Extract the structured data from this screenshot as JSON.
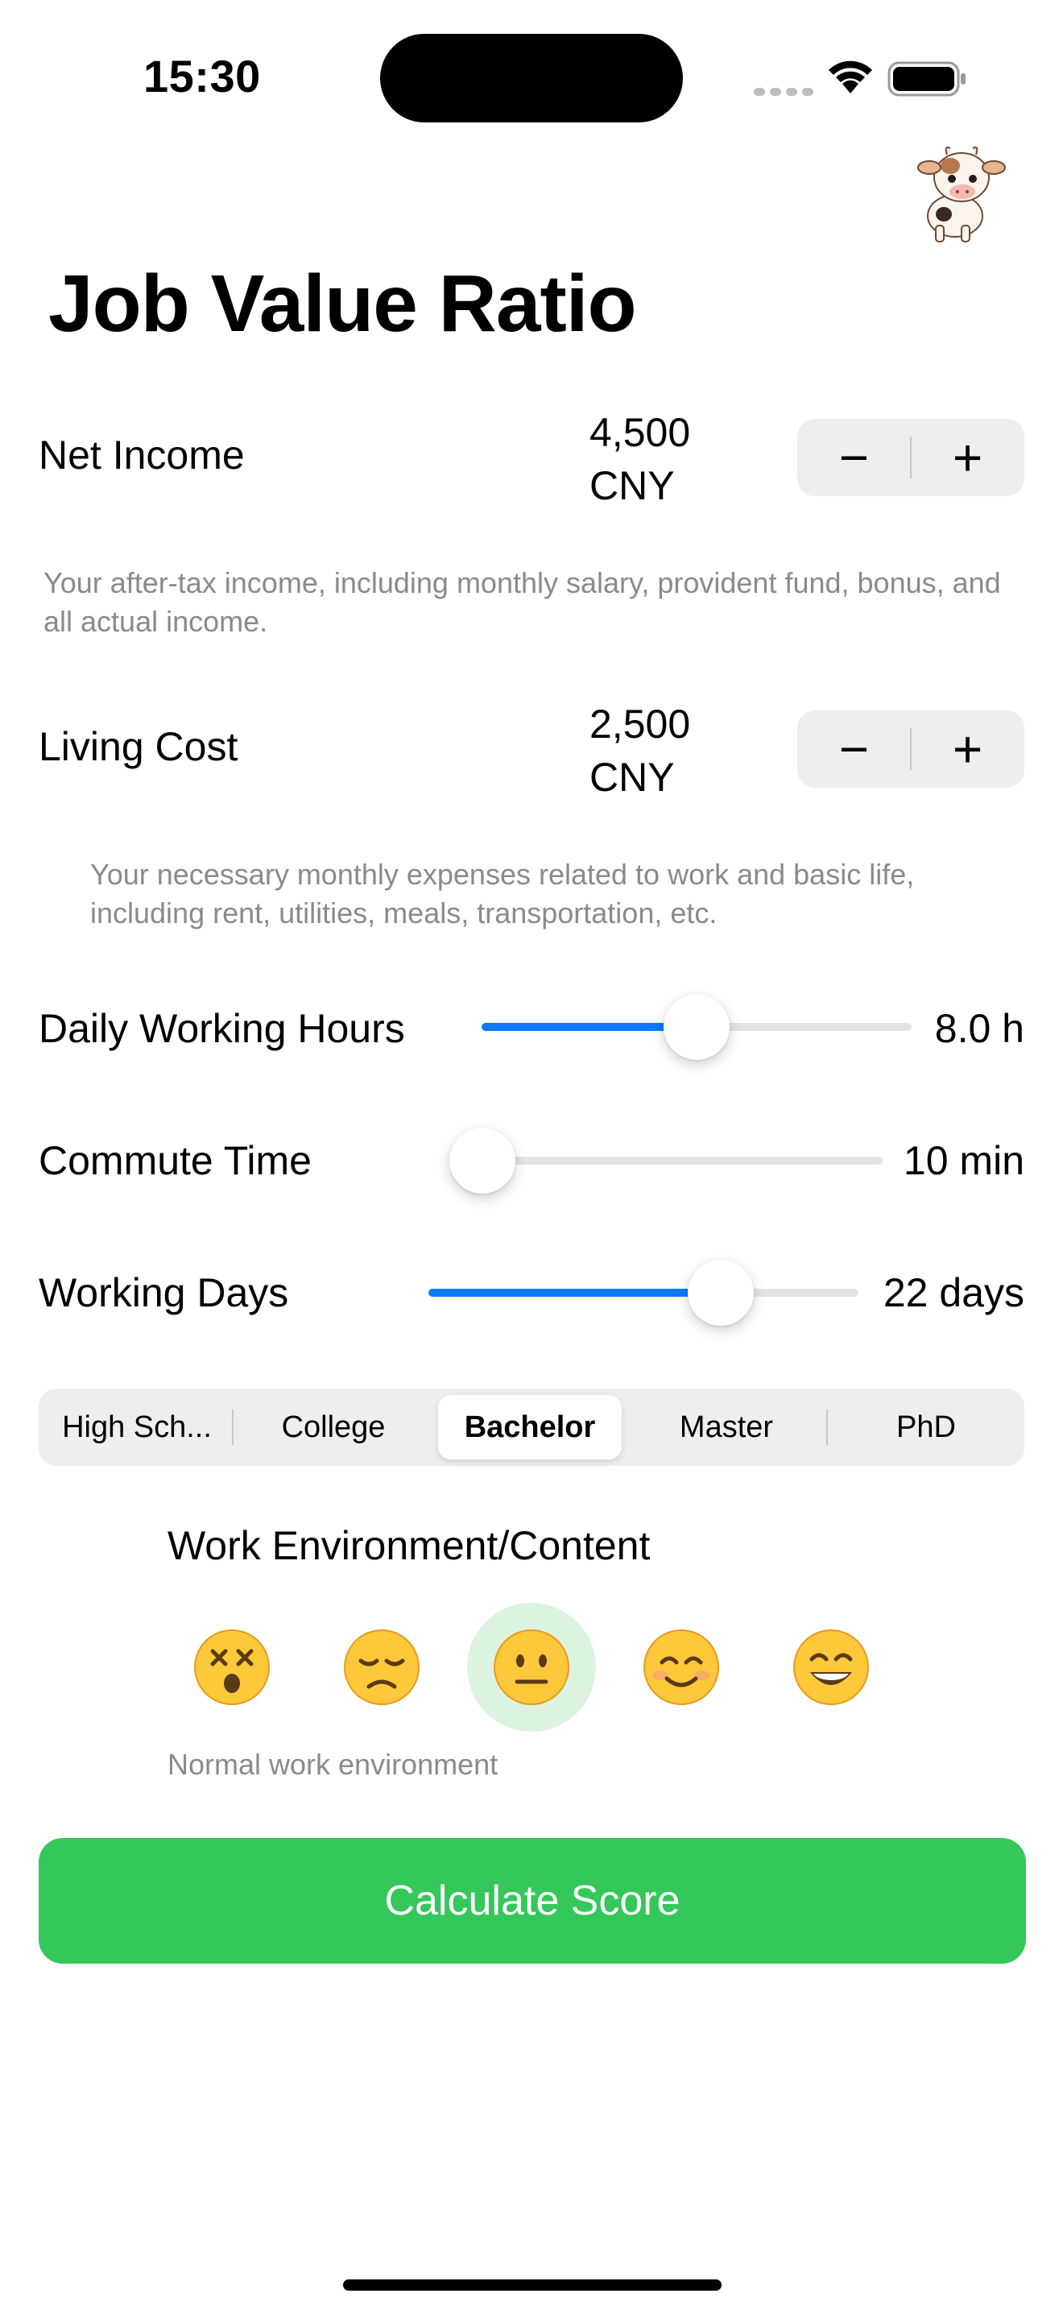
{
  "status_bar": {
    "time": "15:30"
  },
  "title": "Job Value Ratio",
  "net_income": {
    "label": "Net Income",
    "value_line1": "4,500",
    "value_line2": "CNY",
    "helper": "Your after-tax income, including monthly salary, provident fund, bonus, and all actual income.",
    "minus": "−",
    "plus": "+"
  },
  "living_cost": {
    "label": "Living Cost",
    "value_line1": "2,500",
    "value_line2": "CNY",
    "helper": "Your necessary monthly expenses related to work and basic life, including rent, utilities, meals, transportation, etc.",
    "minus": "−",
    "plus": "+"
  },
  "sliders": {
    "working_hours": {
      "label": "Daily Working Hours",
      "value": "8.0 h",
      "fraction": 0.5
    },
    "commute": {
      "label": "Commute Time",
      "value": "10 min",
      "fraction": 0.07
    },
    "working_days": {
      "label": "Working Days",
      "value": "22 days",
      "fraction": 0.68
    }
  },
  "education": {
    "options": [
      "High Sch...",
      "College",
      "Bachelor",
      "Master",
      "PhD"
    ],
    "selected": "Bachelor"
  },
  "environment": {
    "title": "Work Environment/Content",
    "options": [
      "dizzy-face",
      "disappointed-face",
      "neutral-face",
      "smiling-face",
      "grinning-face"
    ],
    "selected": "neutral-face",
    "caption": "Normal work environment"
  },
  "calculate_button": "Calculate Score",
  "colors": {
    "accent": "#0a7aff",
    "button_green": "#34c75a",
    "selected_emoji_bg": "#dcf3e0"
  }
}
